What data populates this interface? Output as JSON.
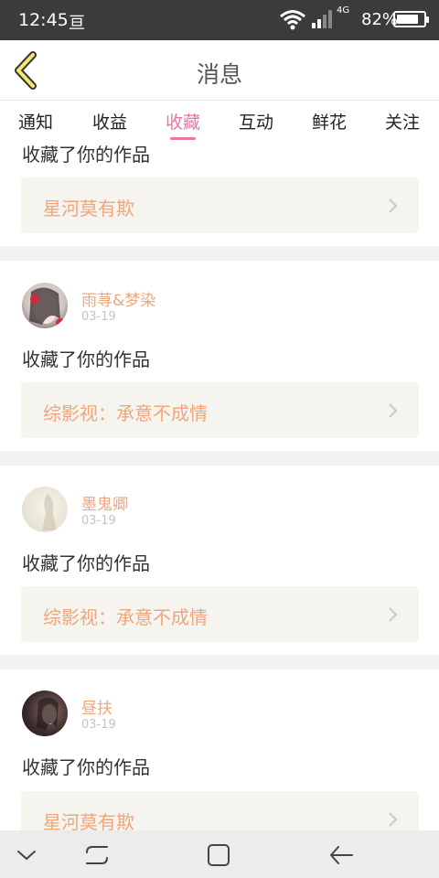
{
  "status_bar": {
    "time": "12:45",
    "app_glyph": "亘",
    "network": "4G",
    "battery_percent": "82%",
    "battery_level": 0.82
  },
  "header": {
    "title": "消息",
    "back_icon": "chevron-left-icon"
  },
  "tabs": [
    {
      "label": "通知",
      "active": false
    },
    {
      "label": "收益",
      "active": false
    },
    {
      "label": "收藏",
      "active": true
    },
    {
      "label": "互动",
      "active": false
    },
    {
      "label": "鲜花",
      "active": false
    },
    {
      "label": "关注",
      "active": false
    }
  ],
  "messages": [
    {
      "user": "",
      "date": "",
      "action": "收藏了你的作品",
      "work": "星河莫有欺"
    },
    {
      "user": "雨荨&梦染",
      "date": "03-19",
      "action": "收藏了你的作品",
      "work": "综影视：承意不成情"
    },
    {
      "user": "墨鬼卿",
      "date": "03-19",
      "action": "收藏了你的作品",
      "work": "综影视：承意不成情"
    },
    {
      "user": "昼扶",
      "date": "03-19",
      "action": "收藏了你的作品",
      "work": "星河莫有欺"
    }
  ],
  "colors": {
    "accent": "#e877a6",
    "name_orange": "#f0a57a",
    "status_bar": "#3b3b3b",
    "back_chevron": "#f2e96a"
  }
}
